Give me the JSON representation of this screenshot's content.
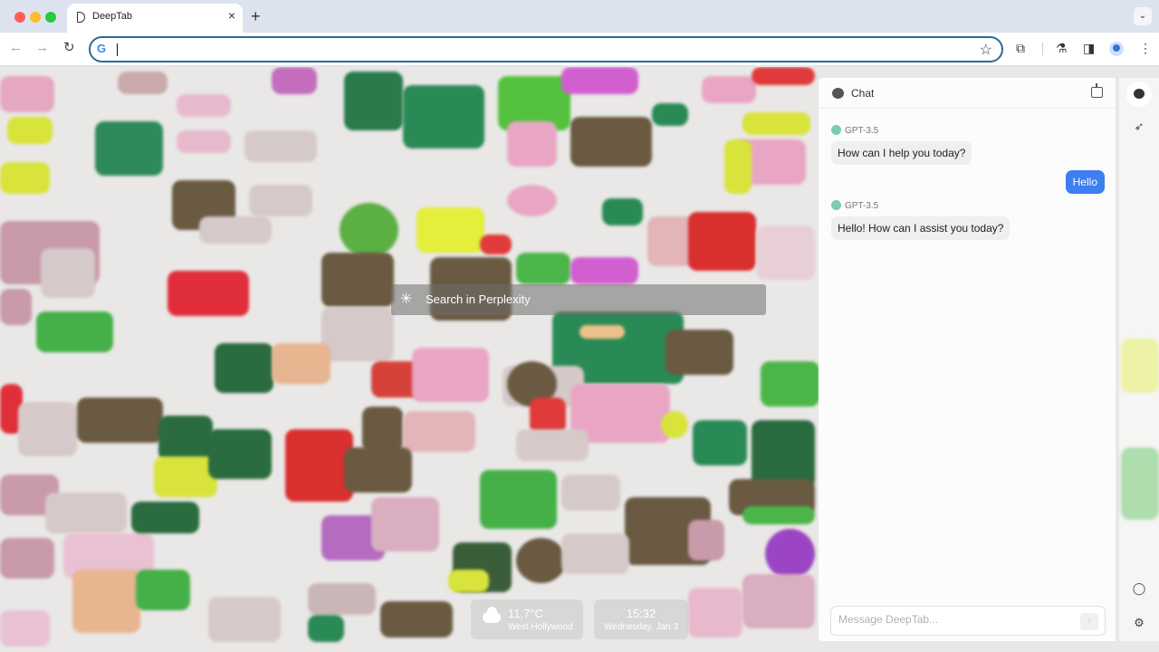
{
  "browser": {
    "tab_title": "DeepTab",
    "tab_close": "×",
    "new_tab": "+",
    "tab_menu": "⌄",
    "omnibox_value": "",
    "google_letter": "G"
  },
  "icons": {
    "back": "←",
    "forward": "→",
    "reload": "↻",
    "star": "☆",
    "extensions": "⧉",
    "labs": "⚗",
    "sidepanel": "◨",
    "more": "⋮",
    "perplexity": "✳",
    "rocket": "➶",
    "user": "◯",
    "gear": "⚙",
    "send": "↑"
  },
  "search": {
    "label": "Search in Perplexity"
  },
  "weather": {
    "temp": "11.7°C",
    "place": "West Hollywood"
  },
  "clock": {
    "time": "15:32",
    "date": "Wednesday, Jan 3"
  },
  "chat": {
    "title": "Chat",
    "messages": [
      {
        "role": "ai",
        "model": "GPT-3.5",
        "text": "How can I help you today?"
      },
      {
        "role": "user",
        "text": "Hello"
      },
      {
        "role": "ai",
        "model": "GPT-3.5",
        "text": "Hello! How can I assist you today?"
      }
    ],
    "input_placeholder": "Message DeepTab..."
  },
  "colors": {
    "accent": "#3d7ef0",
    "omnibox_border": "#2d6a96"
  }
}
